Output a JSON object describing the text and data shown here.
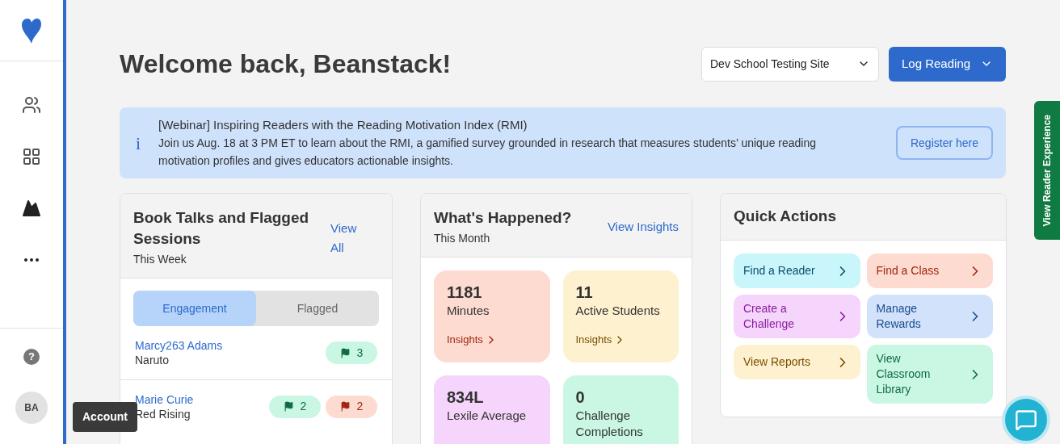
{
  "sidebar": {
    "items": [
      {
        "kind": "people"
      },
      {
        "kind": "grid"
      },
      {
        "kind": "mountain"
      },
      {
        "kind": "more"
      }
    ],
    "help": "?",
    "avatar": "BA",
    "tooltip": "Account"
  },
  "header": {
    "title": "Welcome back, Beanstack!",
    "site_select": "Dev School Testing Site",
    "log_button": "Log Reading"
  },
  "banner": {
    "icon": "i",
    "title": "[Webinar] Inspiring Readers with the Reading Motivation Index (RMI)",
    "body": "Join us Aug. 18 at 3 PM ET to learn about the RMI, a gamified survey grounded in research that measures students’ unique reading motivation profiles and gives educators actionable insights.",
    "button": "Register here"
  },
  "book_talks": {
    "title": "Book Talks and Flagged Sessions",
    "subtitle": "This Week",
    "link": "View All",
    "tabs": [
      {
        "label": "Engagement",
        "selected": true
      },
      {
        "label": "Flagged",
        "selected": false
      }
    ],
    "rows": [
      {
        "name": "Marcy263 Adams",
        "book": "Naruto",
        "badges": [
          {
            "kind": "engagement",
            "count": "3"
          }
        ]
      },
      {
        "name": "Marie Curie",
        "book": "Red Rising",
        "badges": [
          {
            "kind": "engagement",
            "count": "2"
          },
          {
            "kind": "flagged",
            "count": "2"
          }
        ]
      }
    ]
  },
  "whats_happened": {
    "title": "What's Happened?",
    "subtitle": "This Month",
    "link": "View Insights",
    "stats": [
      {
        "value": "1181",
        "label": "Minutes",
        "link": "Insights",
        "color": "#fddbd0"
      },
      {
        "value": "11",
        "label": "Active Students",
        "link": "Insights",
        "color": "#fdf1cf"
      },
      {
        "value": "834L",
        "label": "Lexile Average",
        "color": "#f5d5fb"
      },
      {
        "value": "0",
        "label": "Challenge Completions",
        "color": "#c9f7e3"
      }
    ]
  },
  "quick_actions": {
    "title": "Quick Actions",
    "items": [
      {
        "label": "Find a Reader",
        "color": "#c9f6fb"
      },
      {
        "label": "Find a Class",
        "color": "#fddbd0"
      },
      {
        "label": "Create a Challenge",
        "color": "#f5d5fb"
      },
      {
        "label": "Manage Rewards",
        "color": "#d1e2fa"
      },
      {
        "label": "View Reports",
        "color": "#fdf1cf"
      },
      {
        "label": "View Classroom Library",
        "color": "#c9f7e3"
      }
    ]
  },
  "side_tab": "View Reader Experience"
}
